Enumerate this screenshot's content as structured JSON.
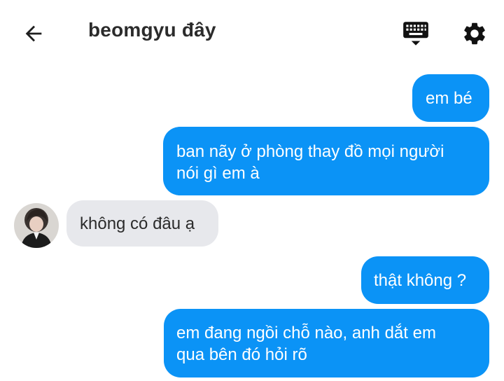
{
  "header": {
    "title": "beomgyu đây"
  },
  "icons": {
    "back": "arrow-back-icon",
    "keyboard": "keyboard-icon",
    "settings": "gear-icon"
  },
  "colors": {
    "outgoing_bubble": "#0b93f6",
    "incoming_bubble": "#e7e8ec",
    "text_dark": "#2b2b2b"
  },
  "messages": [
    {
      "direction": "outgoing",
      "lines": [
        "em bé"
      ]
    },
    {
      "direction": "outgoing",
      "lines": [
        "ban nãy ở phòng thay đồ mọi người",
        "nói gì em à"
      ]
    },
    {
      "direction": "incoming",
      "lines": [
        "không có đâu ạ"
      ]
    },
    {
      "direction": "outgoing",
      "lines": [
        "thật không ?"
      ]
    },
    {
      "direction": "outgoing",
      "lines": [
        "em đang ngồi chỗ nào, anh dắt em",
        "qua bên đó hỏi rõ"
      ]
    }
  ]
}
